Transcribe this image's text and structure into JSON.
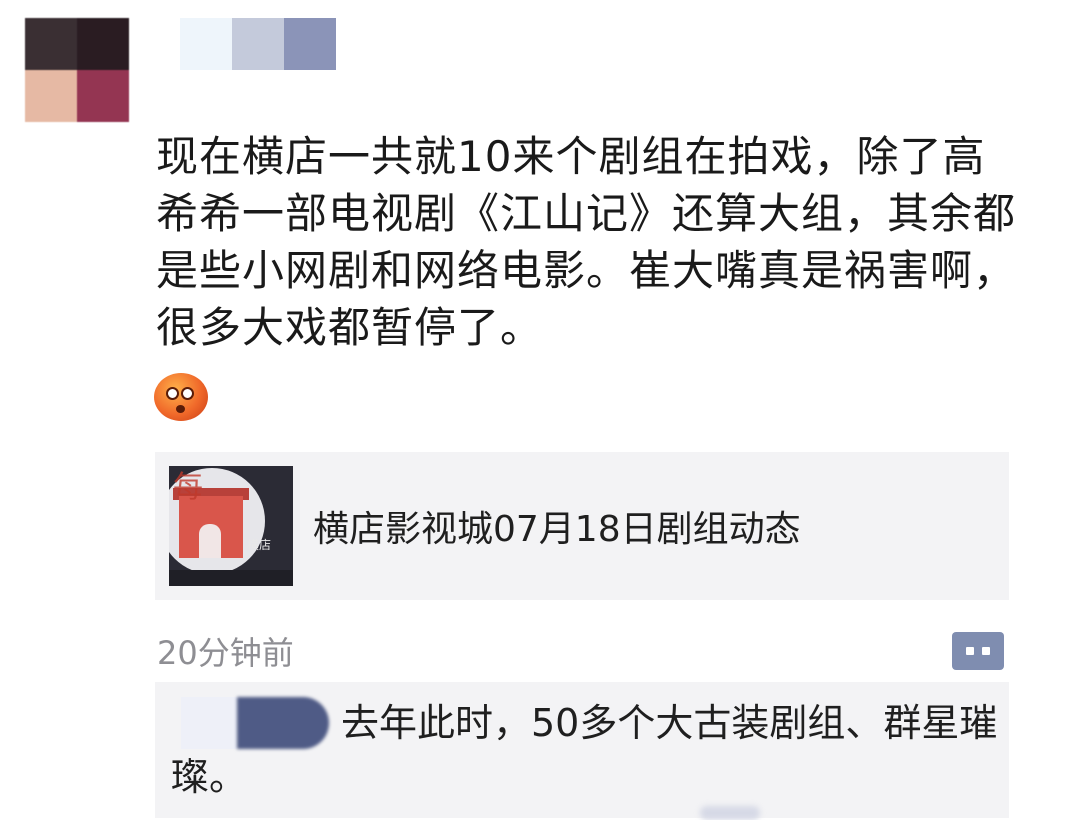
{
  "post": {
    "text": "现在横店一共就10来个剧组在拍戏，除了高希希一部电视剧《江山记》还算大组，其余都是些小网剧和网络电影。崔大嘴真是祸害啊，很多大戏都暂停了。",
    "emoji": "flushed-face-emoji",
    "avatar_colors": [
      "#3a2f33",
      "#2a1c22",
      "#e6b9a4",
      "#943552"
    ],
    "name_mask_colors": [
      "#eef5fb",
      "#c4cadb",
      "#8b94b8"
    ]
  },
  "link_card": {
    "title": "横店影视城07月18日剧组动态"
  },
  "meta": {
    "timestamp": "20分钟前",
    "comment_icon": "comment-icon"
  },
  "comments": [
    {
      "text": "去年此时，50多个大古装剧组、群星璀璨。"
    }
  ],
  "colors": {
    "accent": "#7f8db0",
    "card_bg": "#f3f3f5",
    "timestamp": "#8e8e93"
  }
}
